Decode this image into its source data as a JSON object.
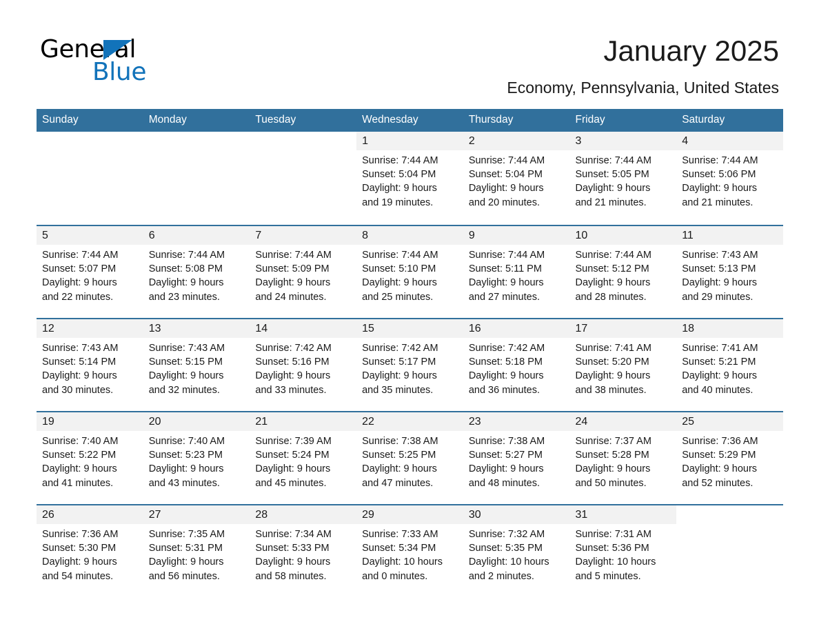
{
  "brand": {
    "name_part1": "General",
    "name_part2": "Blue",
    "triangle_color": "#1273ba"
  },
  "header": {
    "title": "January 2025",
    "subtitle": "Economy, Pennsylvania, United States"
  },
  "theme": {
    "header_bar_color": "#31709c",
    "daynum_strip_color": "#f2f2f2",
    "separator_color": "#31709c",
    "text_color": "#1a1a1a"
  },
  "weekday_headers": [
    "Sunday",
    "Monday",
    "Tuesday",
    "Wednesday",
    "Thursday",
    "Friday",
    "Saturday"
  ],
  "weeks": [
    [
      {
        "blank": true
      },
      {
        "blank": true
      },
      {
        "blank": true
      },
      {
        "day": "1",
        "sunrise": "Sunrise: 7:44 AM",
        "sunset": "Sunset: 5:04 PM",
        "daylight1": "Daylight: 9 hours",
        "daylight2": "and 19 minutes."
      },
      {
        "day": "2",
        "sunrise": "Sunrise: 7:44 AM",
        "sunset": "Sunset: 5:04 PM",
        "daylight1": "Daylight: 9 hours",
        "daylight2": "and 20 minutes."
      },
      {
        "day": "3",
        "sunrise": "Sunrise: 7:44 AM",
        "sunset": "Sunset: 5:05 PM",
        "daylight1": "Daylight: 9 hours",
        "daylight2": "and 21 minutes."
      },
      {
        "day": "4",
        "sunrise": "Sunrise: 7:44 AM",
        "sunset": "Sunset: 5:06 PM",
        "daylight1": "Daylight: 9 hours",
        "daylight2": "and 21 minutes."
      }
    ],
    [
      {
        "day": "5",
        "sunrise": "Sunrise: 7:44 AM",
        "sunset": "Sunset: 5:07 PM",
        "daylight1": "Daylight: 9 hours",
        "daylight2": "and 22 minutes."
      },
      {
        "day": "6",
        "sunrise": "Sunrise: 7:44 AM",
        "sunset": "Sunset: 5:08 PM",
        "daylight1": "Daylight: 9 hours",
        "daylight2": "and 23 minutes."
      },
      {
        "day": "7",
        "sunrise": "Sunrise: 7:44 AM",
        "sunset": "Sunset: 5:09 PM",
        "daylight1": "Daylight: 9 hours",
        "daylight2": "and 24 minutes."
      },
      {
        "day": "8",
        "sunrise": "Sunrise: 7:44 AM",
        "sunset": "Sunset: 5:10 PM",
        "daylight1": "Daylight: 9 hours",
        "daylight2": "and 25 minutes."
      },
      {
        "day": "9",
        "sunrise": "Sunrise: 7:44 AM",
        "sunset": "Sunset: 5:11 PM",
        "daylight1": "Daylight: 9 hours",
        "daylight2": "and 27 minutes."
      },
      {
        "day": "10",
        "sunrise": "Sunrise: 7:44 AM",
        "sunset": "Sunset: 5:12 PM",
        "daylight1": "Daylight: 9 hours",
        "daylight2": "and 28 minutes."
      },
      {
        "day": "11",
        "sunrise": "Sunrise: 7:43 AM",
        "sunset": "Sunset: 5:13 PM",
        "daylight1": "Daylight: 9 hours",
        "daylight2": "and 29 minutes."
      }
    ],
    [
      {
        "day": "12",
        "sunrise": "Sunrise: 7:43 AM",
        "sunset": "Sunset: 5:14 PM",
        "daylight1": "Daylight: 9 hours",
        "daylight2": "and 30 minutes."
      },
      {
        "day": "13",
        "sunrise": "Sunrise: 7:43 AM",
        "sunset": "Sunset: 5:15 PM",
        "daylight1": "Daylight: 9 hours",
        "daylight2": "and 32 minutes."
      },
      {
        "day": "14",
        "sunrise": "Sunrise: 7:42 AM",
        "sunset": "Sunset: 5:16 PM",
        "daylight1": "Daylight: 9 hours",
        "daylight2": "and 33 minutes."
      },
      {
        "day": "15",
        "sunrise": "Sunrise: 7:42 AM",
        "sunset": "Sunset: 5:17 PM",
        "daylight1": "Daylight: 9 hours",
        "daylight2": "and 35 minutes."
      },
      {
        "day": "16",
        "sunrise": "Sunrise: 7:42 AM",
        "sunset": "Sunset: 5:18 PM",
        "daylight1": "Daylight: 9 hours",
        "daylight2": "and 36 minutes."
      },
      {
        "day": "17",
        "sunrise": "Sunrise: 7:41 AM",
        "sunset": "Sunset: 5:20 PM",
        "daylight1": "Daylight: 9 hours",
        "daylight2": "and 38 minutes."
      },
      {
        "day": "18",
        "sunrise": "Sunrise: 7:41 AM",
        "sunset": "Sunset: 5:21 PM",
        "daylight1": "Daylight: 9 hours",
        "daylight2": "and 40 minutes."
      }
    ],
    [
      {
        "day": "19",
        "sunrise": "Sunrise: 7:40 AM",
        "sunset": "Sunset: 5:22 PM",
        "daylight1": "Daylight: 9 hours",
        "daylight2": "and 41 minutes."
      },
      {
        "day": "20",
        "sunrise": "Sunrise: 7:40 AM",
        "sunset": "Sunset: 5:23 PM",
        "daylight1": "Daylight: 9 hours",
        "daylight2": "and 43 minutes."
      },
      {
        "day": "21",
        "sunrise": "Sunrise: 7:39 AM",
        "sunset": "Sunset: 5:24 PM",
        "daylight1": "Daylight: 9 hours",
        "daylight2": "and 45 minutes."
      },
      {
        "day": "22",
        "sunrise": "Sunrise: 7:38 AM",
        "sunset": "Sunset: 5:25 PM",
        "daylight1": "Daylight: 9 hours",
        "daylight2": "and 47 minutes."
      },
      {
        "day": "23",
        "sunrise": "Sunrise: 7:38 AM",
        "sunset": "Sunset: 5:27 PM",
        "daylight1": "Daylight: 9 hours",
        "daylight2": "and 48 minutes."
      },
      {
        "day": "24",
        "sunrise": "Sunrise: 7:37 AM",
        "sunset": "Sunset: 5:28 PM",
        "daylight1": "Daylight: 9 hours",
        "daylight2": "and 50 minutes."
      },
      {
        "day": "25",
        "sunrise": "Sunrise: 7:36 AM",
        "sunset": "Sunset: 5:29 PM",
        "daylight1": "Daylight: 9 hours",
        "daylight2": "and 52 minutes."
      }
    ],
    [
      {
        "day": "26",
        "sunrise": "Sunrise: 7:36 AM",
        "sunset": "Sunset: 5:30 PM",
        "daylight1": "Daylight: 9 hours",
        "daylight2": "and 54 minutes."
      },
      {
        "day": "27",
        "sunrise": "Sunrise: 7:35 AM",
        "sunset": "Sunset: 5:31 PM",
        "daylight1": "Daylight: 9 hours",
        "daylight2": "and 56 minutes."
      },
      {
        "day": "28",
        "sunrise": "Sunrise: 7:34 AM",
        "sunset": "Sunset: 5:33 PM",
        "daylight1": "Daylight: 9 hours",
        "daylight2": "and 58 minutes."
      },
      {
        "day": "29",
        "sunrise": "Sunrise: 7:33 AM",
        "sunset": "Sunset: 5:34 PM",
        "daylight1": "Daylight: 10 hours",
        "daylight2": "and 0 minutes."
      },
      {
        "day": "30",
        "sunrise": "Sunrise: 7:32 AM",
        "sunset": "Sunset: 5:35 PM",
        "daylight1": "Daylight: 10 hours",
        "daylight2": "and 2 minutes."
      },
      {
        "day": "31",
        "sunrise": "Sunrise: 7:31 AM",
        "sunset": "Sunset: 5:36 PM",
        "daylight1": "Daylight: 10 hours",
        "daylight2": "and 5 minutes."
      },
      {
        "blank": true
      }
    ]
  ]
}
